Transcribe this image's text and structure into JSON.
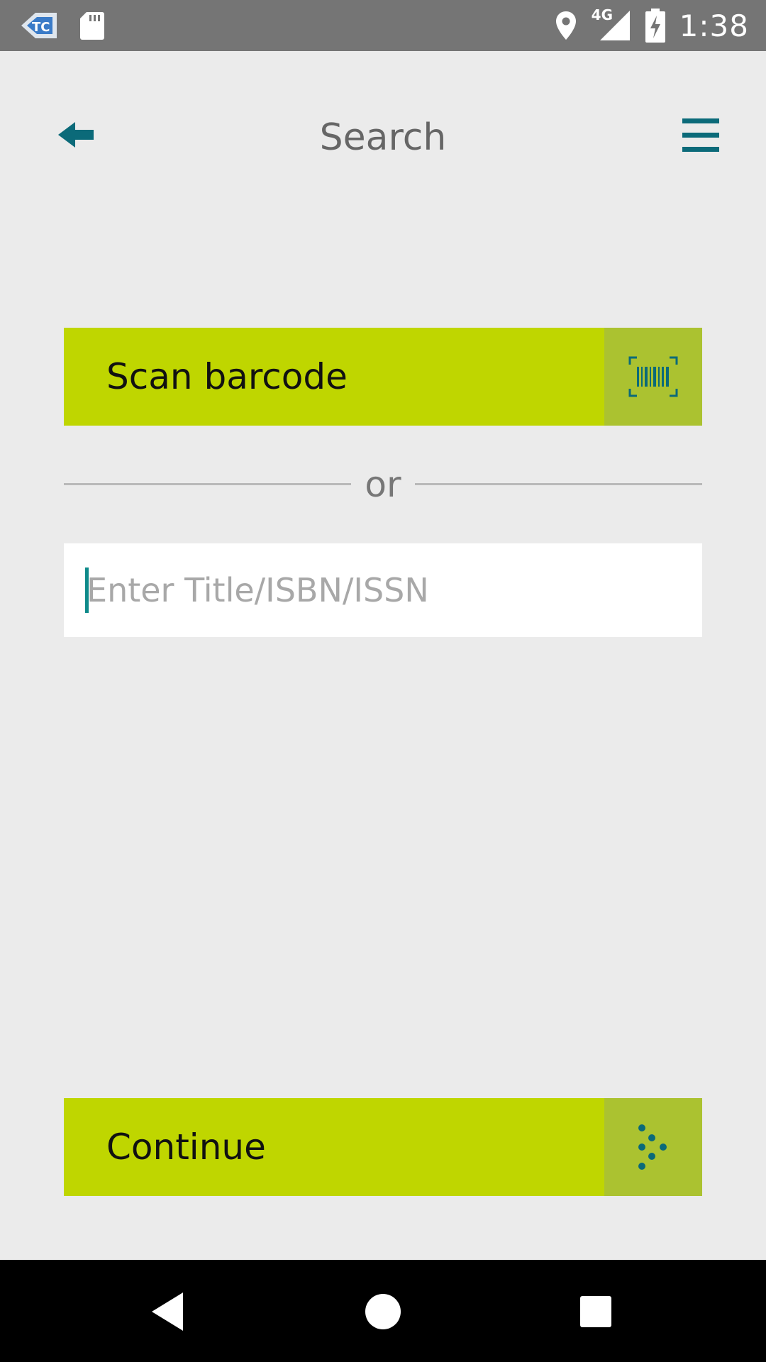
{
  "status_bar": {
    "time": "1:38",
    "network": "4G",
    "icons": [
      "app-badge-icon",
      "sd-card-icon",
      "location-icon",
      "signal-icon",
      "battery-charging-icon"
    ]
  },
  "header": {
    "title": "Search",
    "back_icon": "arrow-left-icon",
    "menu_icon": "hamburger-menu-icon"
  },
  "scan": {
    "label": "Scan barcode",
    "icon": "barcode-scan-icon"
  },
  "divider": {
    "text": "or"
  },
  "search": {
    "placeholder": "Enter Title/ISBN/ISSN",
    "value": ""
  },
  "continue": {
    "label": "Continue",
    "icon": "dotted-arrow-icon"
  },
  "nav": {
    "icons": [
      "nav-back-icon",
      "nav-home-icon",
      "nav-recents-icon"
    ]
  },
  "colors": {
    "accent": "#bfd600",
    "accent_dark": "#abc230",
    "teal": "#0b6a79",
    "background": "#ebebeb"
  }
}
